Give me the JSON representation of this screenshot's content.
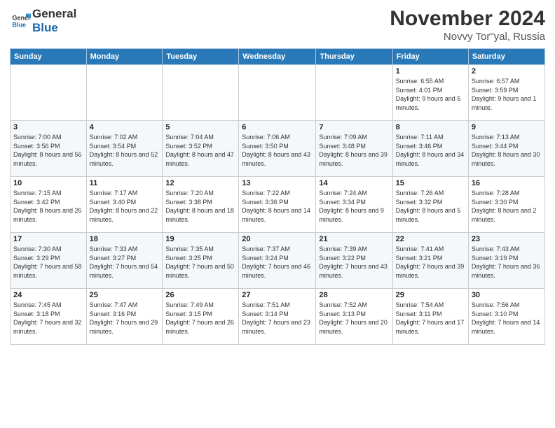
{
  "logo": {
    "line1": "General",
    "line2": "Blue"
  },
  "title": "November 2024",
  "location": "Novvy Tor\"yal, Russia",
  "days_header": [
    "Sunday",
    "Monday",
    "Tuesday",
    "Wednesday",
    "Thursday",
    "Friday",
    "Saturday"
  ],
  "weeks": [
    [
      {
        "num": "",
        "info": ""
      },
      {
        "num": "",
        "info": ""
      },
      {
        "num": "",
        "info": ""
      },
      {
        "num": "",
        "info": ""
      },
      {
        "num": "",
        "info": ""
      },
      {
        "num": "1",
        "sunrise": "Sunrise: 6:55 AM",
        "sunset": "Sunset: 4:01 PM",
        "daylight": "Daylight: 9 hours and 5 minutes."
      },
      {
        "num": "2",
        "sunrise": "Sunrise: 6:57 AM",
        "sunset": "Sunset: 3:59 PM",
        "daylight": "Daylight: 9 hours and 1 minute."
      }
    ],
    [
      {
        "num": "3",
        "sunrise": "Sunrise: 7:00 AM",
        "sunset": "Sunset: 3:56 PM",
        "daylight": "Daylight: 8 hours and 56 minutes."
      },
      {
        "num": "4",
        "sunrise": "Sunrise: 7:02 AM",
        "sunset": "Sunset: 3:54 PM",
        "daylight": "Daylight: 8 hours and 52 minutes."
      },
      {
        "num": "5",
        "sunrise": "Sunrise: 7:04 AM",
        "sunset": "Sunset: 3:52 PM",
        "daylight": "Daylight: 8 hours and 47 minutes."
      },
      {
        "num": "6",
        "sunrise": "Sunrise: 7:06 AM",
        "sunset": "Sunset: 3:50 PM",
        "daylight": "Daylight: 8 hours and 43 minutes."
      },
      {
        "num": "7",
        "sunrise": "Sunrise: 7:09 AM",
        "sunset": "Sunset: 3:48 PM",
        "daylight": "Daylight: 8 hours and 39 minutes."
      },
      {
        "num": "8",
        "sunrise": "Sunrise: 7:11 AM",
        "sunset": "Sunset: 3:46 PM",
        "daylight": "Daylight: 8 hours and 34 minutes."
      },
      {
        "num": "9",
        "sunrise": "Sunrise: 7:13 AM",
        "sunset": "Sunset: 3:44 PM",
        "daylight": "Daylight: 8 hours and 30 minutes."
      }
    ],
    [
      {
        "num": "10",
        "sunrise": "Sunrise: 7:15 AM",
        "sunset": "Sunset: 3:42 PM",
        "daylight": "Daylight: 8 hours and 26 minutes."
      },
      {
        "num": "11",
        "sunrise": "Sunrise: 7:17 AM",
        "sunset": "Sunset: 3:40 PM",
        "daylight": "Daylight: 8 hours and 22 minutes."
      },
      {
        "num": "12",
        "sunrise": "Sunrise: 7:20 AM",
        "sunset": "Sunset: 3:38 PM",
        "daylight": "Daylight: 8 hours and 18 minutes."
      },
      {
        "num": "13",
        "sunrise": "Sunrise: 7:22 AM",
        "sunset": "Sunset: 3:36 PM",
        "daylight": "Daylight: 8 hours and 14 minutes."
      },
      {
        "num": "14",
        "sunrise": "Sunrise: 7:24 AM",
        "sunset": "Sunset: 3:34 PM",
        "daylight": "Daylight: 8 hours and 9 minutes."
      },
      {
        "num": "15",
        "sunrise": "Sunrise: 7:26 AM",
        "sunset": "Sunset: 3:32 PM",
        "daylight": "Daylight: 8 hours and 5 minutes."
      },
      {
        "num": "16",
        "sunrise": "Sunrise: 7:28 AM",
        "sunset": "Sunset: 3:30 PM",
        "daylight": "Daylight: 8 hours and 2 minutes."
      }
    ],
    [
      {
        "num": "17",
        "sunrise": "Sunrise: 7:30 AM",
        "sunset": "Sunset: 3:29 PM",
        "daylight": "Daylight: 7 hours and 58 minutes."
      },
      {
        "num": "18",
        "sunrise": "Sunrise: 7:33 AM",
        "sunset": "Sunset: 3:27 PM",
        "daylight": "Daylight: 7 hours and 54 minutes."
      },
      {
        "num": "19",
        "sunrise": "Sunrise: 7:35 AM",
        "sunset": "Sunset: 3:25 PM",
        "daylight": "Daylight: 7 hours and 50 minutes."
      },
      {
        "num": "20",
        "sunrise": "Sunrise: 7:37 AM",
        "sunset": "Sunset: 3:24 PM",
        "daylight": "Daylight: 7 hours and 46 minutes."
      },
      {
        "num": "21",
        "sunrise": "Sunrise: 7:39 AM",
        "sunset": "Sunset: 3:22 PM",
        "daylight": "Daylight: 7 hours and 43 minutes."
      },
      {
        "num": "22",
        "sunrise": "Sunrise: 7:41 AM",
        "sunset": "Sunset: 3:21 PM",
        "daylight": "Daylight: 7 hours and 39 minutes."
      },
      {
        "num": "23",
        "sunrise": "Sunrise: 7:43 AM",
        "sunset": "Sunset: 3:19 PM",
        "daylight": "Daylight: 7 hours and 36 minutes."
      }
    ],
    [
      {
        "num": "24",
        "sunrise": "Sunrise: 7:45 AM",
        "sunset": "Sunset: 3:18 PM",
        "daylight": "Daylight: 7 hours and 32 minutes."
      },
      {
        "num": "25",
        "sunrise": "Sunrise: 7:47 AM",
        "sunset": "Sunset: 3:16 PM",
        "daylight": "Daylight: 7 hours and 29 minutes."
      },
      {
        "num": "26",
        "sunrise": "Sunrise: 7:49 AM",
        "sunset": "Sunset: 3:15 PM",
        "daylight": "Daylight: 7 hours and 26 minutes."
      },
      {
        "num": "27",
        "sunrise": "Sunrise: 7:51 AM",
        "sunset": "Sunset: 3:14 PM",
        "daylight": "Daylight: 7 hours and 23 minutes."
      },
      {
        "num": "28",
        "sunrise": "Sunrise: 7:52 AM",
        "sunset": "Sunset: 3:13 PM",
        "daylight": "Daylight: 7 hours and 20 minutes."
      },
      {
        "num": "29",
        "sunrise": "Sunrise: 7:54 AM",
        "sunset": "Sunset: 3:11 PM",
        "daylight": "Daylight: 7 hours and 17 minutes."
      },
      {
        "num": "30",
        "sunrise": "Sunrise: 7:56 AM",
        "sunset": "Sunset: 3:10 PM",
        "daylight": "Daylight: 7 hours and 14 minutes."
      }
    ]
  ]
}
